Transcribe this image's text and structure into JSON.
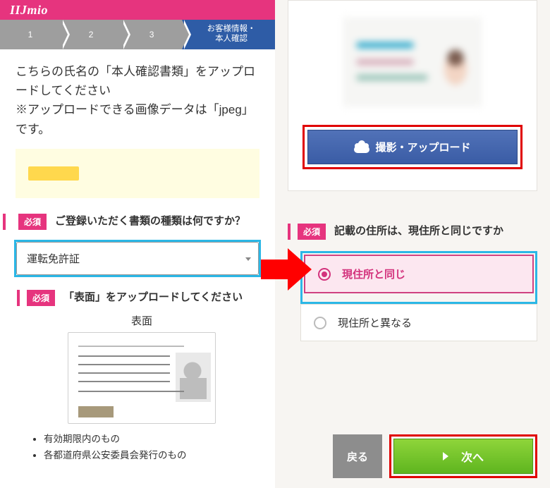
{
  "brand": "IIJmio",
  "steps": {
    "s1": "1",
    "s2": "2",
    "s3": "3",
    "active": "お客様情報・\n本人確認"
  },
  "instruction": "こちらの氏名の「本人確認書類」をアップロードしてください\n※アップロードできる画像データは「jpeg」です。",
  "required_label": "必須",
  "doc_type_question": "ご登録いただく書類の種類は何ですか？",
  "doc_type_selected": "運転免許証",
  "upload_front_title": "「表面」をアップロードしてください",
  "card_face_label": "表面",
  "bullets": [
    "有効期限内のもの",
    "各都道府県公安委員会発行のもの"
  ],
  "upload_button": "撮影・アップロード",
  "address_question": "記載の住所は、現住所と同じですか",
  "radio_same": "現住所と同じ",
  "radio_diff": "現住所と異なる",
  "back_button": "戻る",
  "next_button": "次へ"
}
